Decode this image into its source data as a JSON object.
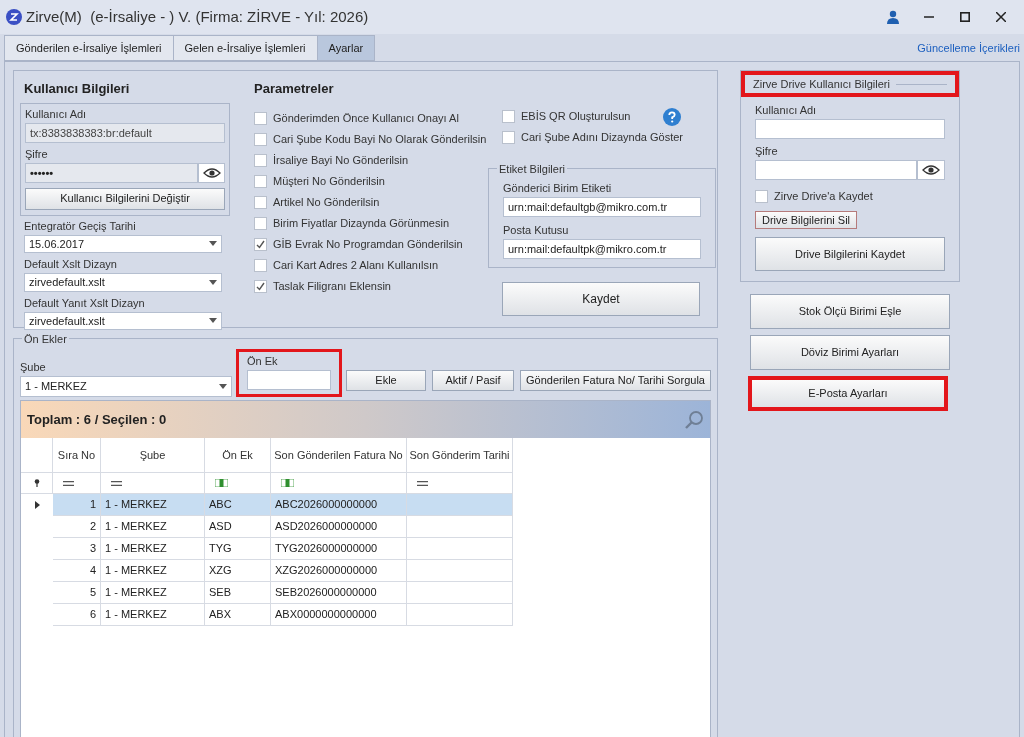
{
  "window": {
    "title": "Zirve(M)  (e-İrsaliye - ) V. (Firma: ZİRVE - Yıl: 2026)"
  },
  "tabs": [
    {
      "label": "Gönderilen e-İrsaliye İşlemleri",
      "selected": false
    },
    {
      "label": "Gelen e-İrsaliye İşlemleri",
      "selected": false
    },
    {
      "label": "Ayarlar",
      "selected": true
    }
  ],
  "update_link": "Güncelleme İçerikleri",
  "user_info": {
    "title": "Kullanıcı Bilgileri",
    "username_label": "Kullanıcı Adı",
    "username_value": "tx:8383838383:br:default",
    "password_label": "Şifre",
    "password_value": "••••••",
    "change_button": "Kullanıcı Bilgilerini Değiştir",
    "integrator_date_label": "Entegratör Geçiş Tarihi",
    "integrator_date_value": "15.06.2017",
    "xslt_label": "Default Xslt Dizayn",
    "xslt_value": "zirvedefault.xslt",
    "reply_xslt_label": "Default Yanıt Xslt Dizayn",
    "reply_xslt_value": "zirvedefault.xslt"
  },
  "parameters": {
    "title": "Parametreler",
    "options": [
      {
        "label": "Gönderimden Önce Kullanıcı Onayı Al",
        "checked": false
      },
      {
        "label": "Cari Şube Kodu Bayi No Olarak Gönderilsin",
        "checked": false
      },
      {
        "label": "İrsaliye Bayi No Gönderilsin",
        "checked": false
      },
      {
        "label": "Müşteri No Gönderilsin",
        "checked": false
      },
      {
        "label": "Artikel No Gönderilsin",
        "checked": false
      },
      {
        "label": "Birim Fiyatlar Dizaynda Görünmesin",
        "checked": false
      },
      {
        "label": "GİB Evrak No Programdan Gönderilsin",
        "checked": true
      },
      {
        "label": "Cari Kart Adres 2 Alanı Kullanılsın",
        "checked": false
      },
      {
        "label": "Taslak Filigranı Eklensin",
        "checked": true
      }
    ],
    "options_right": [
      {
        "label": "EBİS QR Oluşturulsun",
        "checked": false
      },
      {
        "label": "Cari Şube Adını Dizaynda Göster",
        "checked": false
      }
    ]
  },
  "label_info": {
    "title": "Etiket Bilgileri",
    "sender_label": "Gönderici Birim Etiketi",
    "sender_value": "urn:mail:defaultgb@mikro.com.tr",
    "mailbox_label": "Posta Kutusu",
    "mailbox_value": "urn:mail:defaultpk@mikro.com.tr"
  },
  "save_button": "Kaydet",
  "drive": {
    "title": "Zirve Drive Kullanıcı Bilgileri",
    "highlighted": true,
    "username_label": "Kullanıcı Adı",
    "password_label": "Şifre",
    "save_to_drive": {
      "label": "Zirve Drive'a Kaydet",
      "checked": false
    },
    "delete_button": "Drive Bilgilerini Sil",
    "save_button": "Drive Bilgilerini Kaydet"
  },
  "side_buttons": [
    {
      "label": "Stok Ölçü Birimi Eşle",
      "highlighted": false
    },
    {
      "label": "Döviz Birimi Ayarları",
      "highlighted": false
    },
    {
      "label": "E-Posta Ayarları",
      "highlighted": true
    }
  ],
  "prefixes": {
    "title": "Ön Ekler",
    "branch_label": "Şube",
    "branch_value": "1 - MERKEZ",
    "prefix_label": "Ön Ek",
    "prefix_highlighted": true,
    "buttons": [
      "Ekle",
      "Aktif / Pasif",
      "Gönderilen Fatura No/ Tarihi Sorgula"
    ],
    "summary": "Toplam : 6 / Seçilen : 0",
    "columns": [
      {
        "label": "Sıra No",
        "kind": "equals"
      },
      {
        "label": "Şube",
        "kind": "equals"
      },
      {
        "label": "Ön Ek",
        "kind": "text"
      },
      {
        "label": "Son Gönderilen Fatura No",
        "kind": "text"
      },
      {
        "label": "Son Gönderim Tarihi",
        "kind": "equals"
      }
    ],
    "rows": [
      {
        "cells": [
          "1",
          "1 - MERKEZ",
          "ABC",
          "ABC2026000000000",
          ""
        ],
        "selected": true
      },
      {
        "cells": [
          "2",
          "1 - MERKEZ",
          "ASD",
          "ASD2026000000000",
          ""
        ],
        "selected": false
      },
      {
        "cells": [
          "3",
          "1 - MERKEZ",
          "TYG",
          "TYG2026000000000",
          ""
        ],
        "selected": false
      },
      {
        "cells": [
          "4",
          "1 - MERKEZ",
          "XZG",
          "XZG2026000000000",
          ""
        ],
        "selected": false
      },
      {
        "cells": [
          "5",
          "1 - MERKEZ",
          "SEB",
          "SEB2026000000000",
          ""
        ],
        "selected": false
      },
      {
        "cells": [
          "6",
          "1 - MERKEZ",
          "ABX",
          "ABX0000000000000",
          ""
        ],
        "selected": false
      }
    ]
  }
}
